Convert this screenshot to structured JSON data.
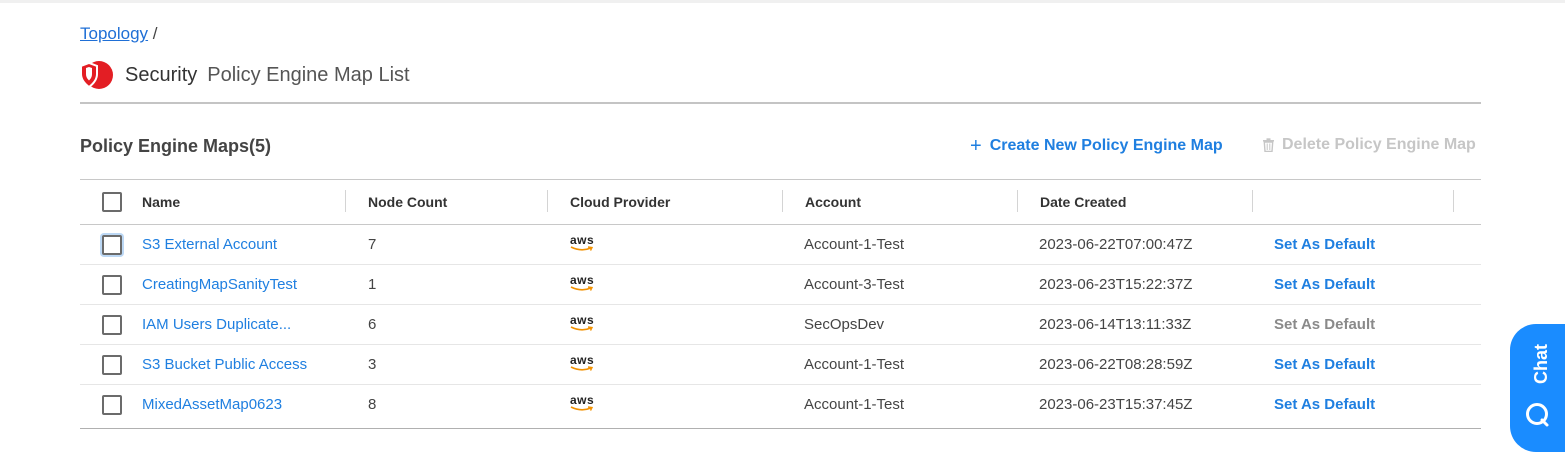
{
  "breadcrumb": {
    "root": "Topology",
    "sep": "/"
  },
  "header": {
    "title": "Security",
    "subtitle": "Policy Engine Map List"
  },
  "section": {
    "title": "Policy Engine Maps(5)",
    "create_label": "Create New Policy Engine Map",
    "create_icon": "plus-icon",
    "delete_label": "Delete Policy Engine Map",
    "delete_icon": "trash-icon"
  },
  "table": {
    "columns": {
      "name": "Name",
      "node_count": "Node Count",
      "cloud_provider": "Cloud Provider",
      "account": "Account",
      "date_created": "Date Created"
    },
    "rows": [
      {
        "name": "S3 External Account",
        "node_count": "7",
        "provider": "aws",
        "account": "Account-1-Test",
        "date": "2023-06-22T07:00:47Z",
        "action": "Set As Default"
      },
      {
        "name": "CreatingMapSanityTest",
        "node_count": "1",
        "provider": "aws",
        "account": "Account-3-Test",
        "date": "2023-06-23T15:22:37Z",
        "action": "Set As Default"
      },
      {
        "name": "IAM Users Duplicate...",
        "node_count": "6",
        "provider": "aws",
        "account": "SecOpsDev",
        "date": "2023-06-14T13:11:33Z",
        "action": "Set As Default"
      },
      {
        "name": "S3 Bucket Public Access",
        "node_count": "3",
        "provider": "aws",
        "account": "Account-1-Test",
        "date": "2023-06-22T08:28:59Z",
        "action": "Set As Default"
      },
      {
        "name": "MixedAssetMap0623",
        "node_count": "8",
        "provider": "aws",
        "account": "Account-1-Test",
        "date": "2023-06-23T15:37:45Z",
        "action": "Set As Default"
      }
    ]
  },
  "chat": {
    "label": "Chat",
    "icon": "chat-bubble-icon"
  },
  "colors": {
    "accent": "#1f7fe0",
    "brand_red": "#e31e24",
    "chat_blue": "#1a8cff",
    "disabled": "#c6c6c6"
  }
}
